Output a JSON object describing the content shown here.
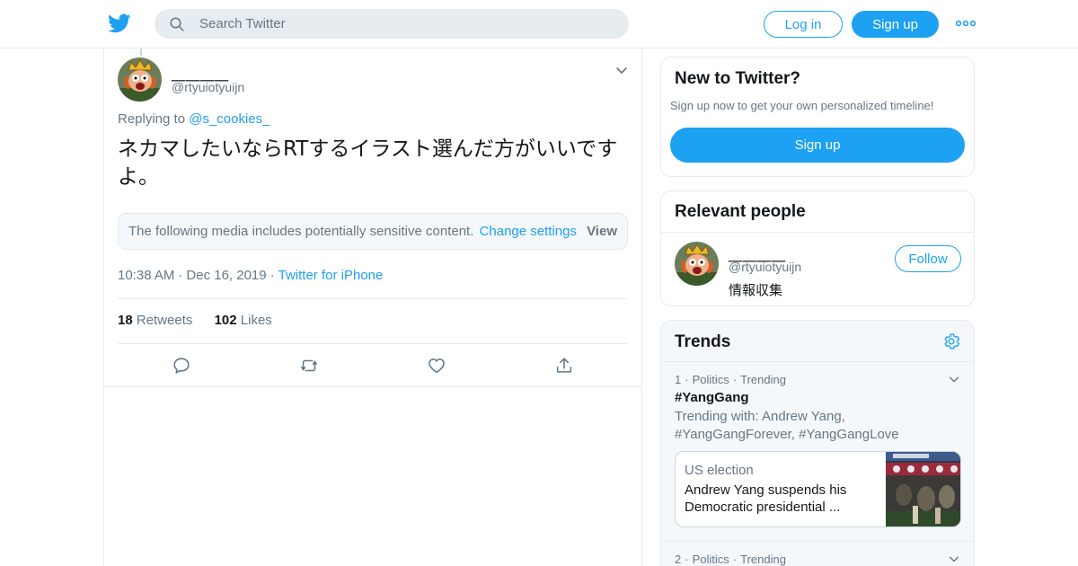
{
  "header": {
    "search_placeholder": "Search Twitter",
    "login_label": "Log in",
    "signup_label": "Sign up"
  },
  "tweet": {
    "author_name": "＿＿＿＿",
    "author_handle": "@rtyuiotyuijn",
    "replying_prefix": "Replying to",
    "replying_to": "@s_cookies_",
    "text": "ネカマしたいならRTするイラスト選んだ方がいいですよ。",
    "sensitive_message": "The following media includes potentially sensitive content.",
    "change_settings": "Change settings",
    "view_label": "View",
    "time": "10:38 AM",
    "date": "Dec 16, 2019",
    "source": "Twitter for iPhone",
    "retweet_count": "18",
    "retweet_label": "Retweets",
    "like_count": "102",
    "like_label": "Likes"
  },
  "new_to_twitter": {
    "title": "New to Twitter?",
    "subtitle": "Sign up now to get your own personalized timeline!",
    "signup_label": "Sign up"
  },
  "relevant_people": {
    "title": "Relevant people",
    "name": "＿＿＿＿",
    "handle": "@rtyuiotyuijn",
    "bio": "情報収集",
    "follow_label": "Follow"
  },
  "trends": {
    "title": "Trends",
    "items": [
      {
        "rank": "1",
        "category": "Politics",
        "status": "Trending",
        "name": "#YangGang",
        "trending_with": "Trending with: Andrew Yang, #YangGangForever, #YangGangLove",
        "story_category": "US election",
        "story_headline": "Andrew Yang suspends his Democratic presidential ..."
      },
      {
        "rank": "2",
        "category": "Politics",
        "status": "Trending"
      }
    ]
  },
  "colors": {
    "accent": "#1da1f2",
    "text_primary": "#14171a",
    "text_secondary": "#657786",
    "border": "#e6ecf0"
  }
}
